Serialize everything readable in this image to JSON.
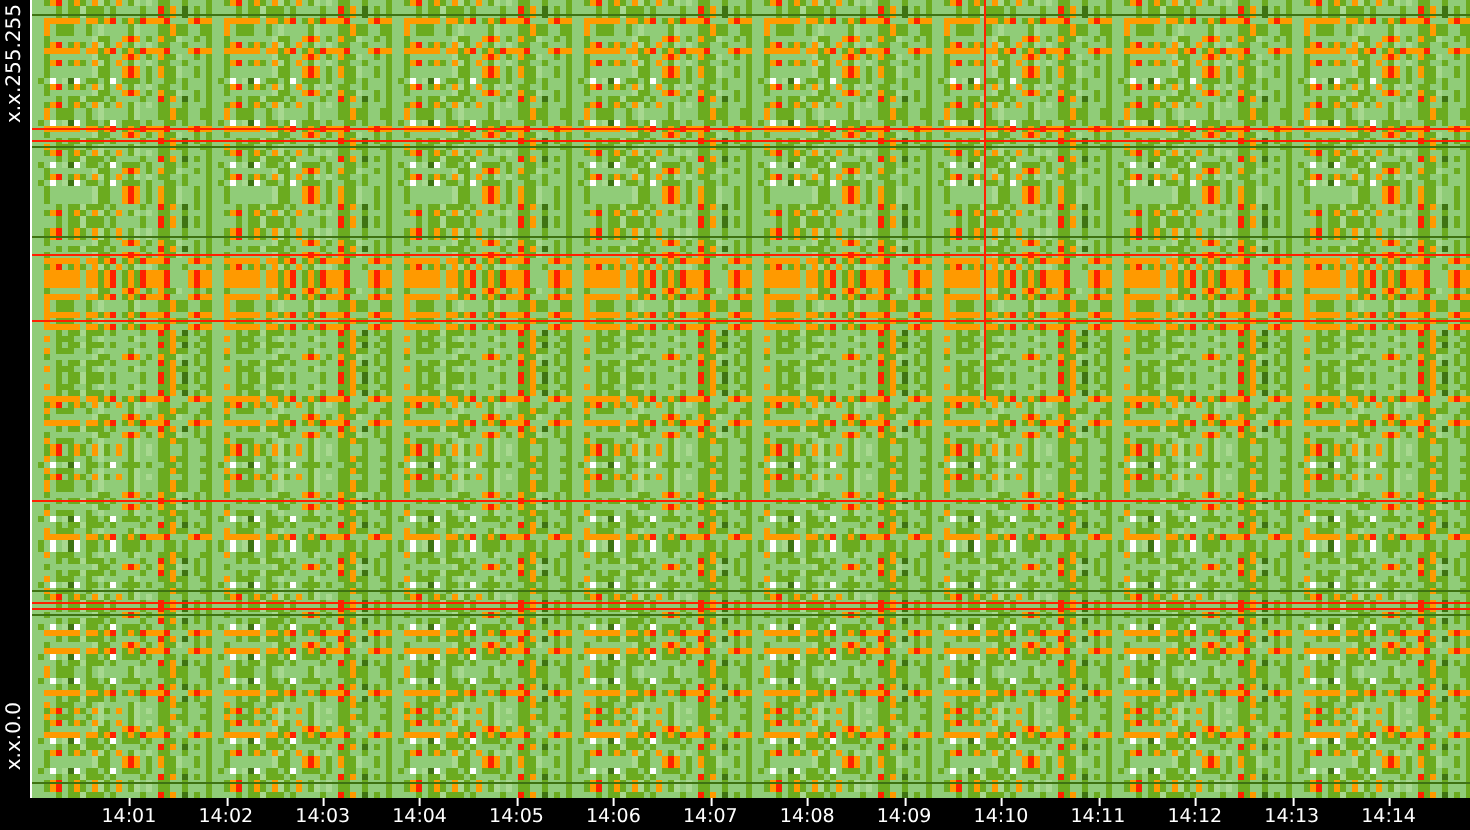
{
  "y_axis": {
    "labels": [
      "x.x.255.255",
      "x.x.0.0"
    ]
  },
  "x_axis": {
    "ticks": [
      "14:01",
      "14:02",
      "14:03",
      "14:04",
      "14:05",
      "14:06",
      "14:07",
      "14:08",
      "14:09",
      "14:10",
      "14:11",
      "14:12",
      "14:13",
      "14:14"
    ]
  }
}
